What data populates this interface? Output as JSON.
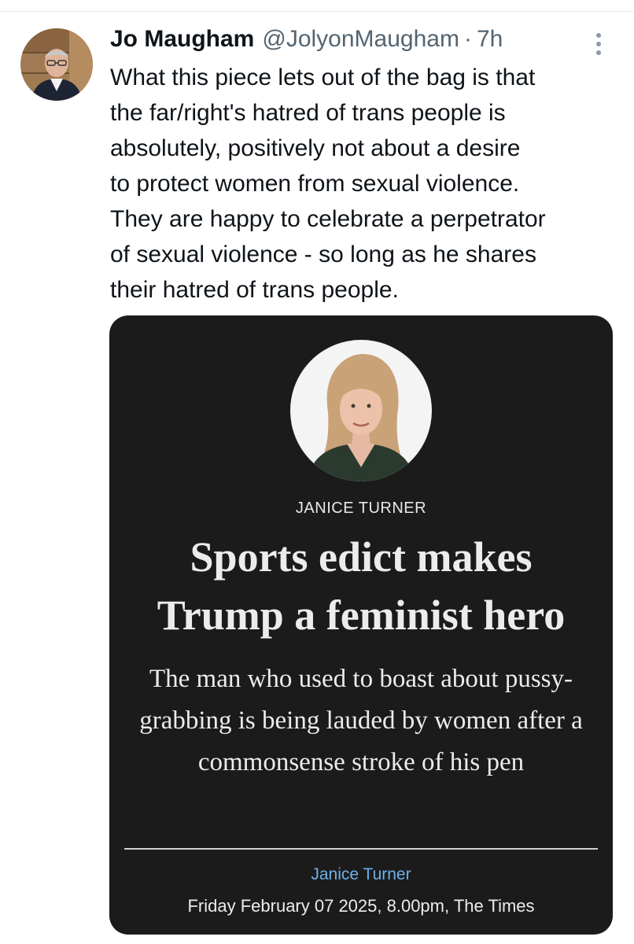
{
  "tweet": {
    "author_name": "Jo Maugham",
    "author_handle": "@JolyonMaugham",
    "separator": "·",
    "time_ago": "7h",
    "text": "What this piece lets out of the bag is that\nthe far/right's hatred of trans people is\nabsolutely, positively not about a desire\nto protect women from sexual violence.\nThey are happy to celebrate a perpetrator\nof sexual violence - so long as he shares\ntheir hatred of trans people."
  },
  "article_card": {
    "columnist": "JANICE TURNER",
    "headline": "Sports edict makes Trump a feminist hero",
    "standfirst": "The man who used to boast about pussy-grabbing is being lauded by women after a commonsense stroke of his pen",
    "author_link": "Janice Turner",
    "dateline": "Friday February 07 2025, 8.00pm, The Times"
  },
  "icons": {
    "more": "more-vertical-icon"
  },
  "colors": {
    "text_primary": "#0f1419",
    "text_secondary": "#536471",
    "card_background": "#1b1b1b",
    "card_link": "#6fb0e8"
  }
}
